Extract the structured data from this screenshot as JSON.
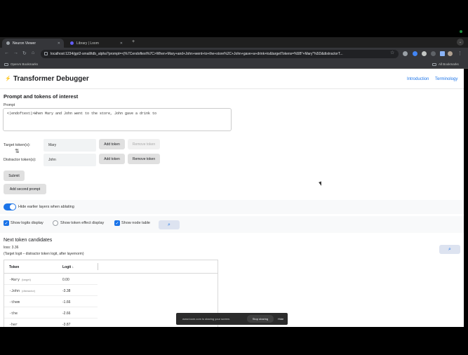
{
  "browser": {
    "tabs": [
      {
        "label": "Neuron Viewer",
        "active": true
      },
      {
        "label": "Library | Loom",
        "active": false
      }
    ],
    "new_tab": "+",
    "url": "localhost:1234/gpt2-small/tdb_alpha?prompt=<|%7Cendoftext%7C>When+Mary+and+John+went+to+the+store%2C+John+gave+a+drink+to&targetTokens=%5B\"+Mary\"%5D&distractorT...",
    "bookmarks": {
      "left": "OpenAI Bookmarks",
      "right": "All Bookmarks"
    }
  },
  "app": {
    "title": "Transformer Debugger",
    "nav": {
      "introduction": "Introduction",
      "terminology": "Terminology"
    }
  },
  "prompt_section": {
    "title": "Prompt and tokens of interest",
    "prompt_label": "Prompt",
    "prompt_value": "<|endoftext|>When Mary and John went to the store, John gave a drink to",
    "target_label": "Target token(s):",
    "target_value": "Mary",
    "distractor_label": "Distractor token(s):",
    "distractor_value": "John",
    "add_token": "Add token",
    "remove_token": "Remove token",
    "submit": "Submit",
    "add_second_prompt": "Add second prompt"
  },
  "settings": {
    "hide_layers": "Hide earlier layers when ablating",
    "show_logits": "Show logits display",
    "show_token_effect": "Show token effect display",
    "show_node_table": "Show node table"
  },
  "candidates": {
    "title": "Next token candidates",
    "loss": "loss: 3.36",
    "subtitle": "(Target logit – distractor token logit, after layernorm)",
    "columns": {
      "token": "Token",
      "logit": "Logit ↓"
    },
    "rows": [
      {
        "token": "·Mary",
        "tag": "(target)",
        "logit": "0.00"
      },
      {
        "token": "·John",
        "tag": "(distractor)",
        "logit": "-3.38"
      },
      {
        "token": "·them",
        "tag": "",
        "logit": "-1.66"
      },
      {
        "token": "·the",
        "tag": "",
        "logit": "-2.66"
      },
      {
        "token": "·her",
        "tag": "",
        "logit": "-3.87"
      }
    ]
  },
  "share_bar": {
    "message": "www.loom.com is sharing your screen.",
    "stop": "Stop sharing",
    "hide": "Hide"
  },
  "colors": {
    "accent": "#1a73e8",
    "chrome_dark": "#35363a"
  }
}
